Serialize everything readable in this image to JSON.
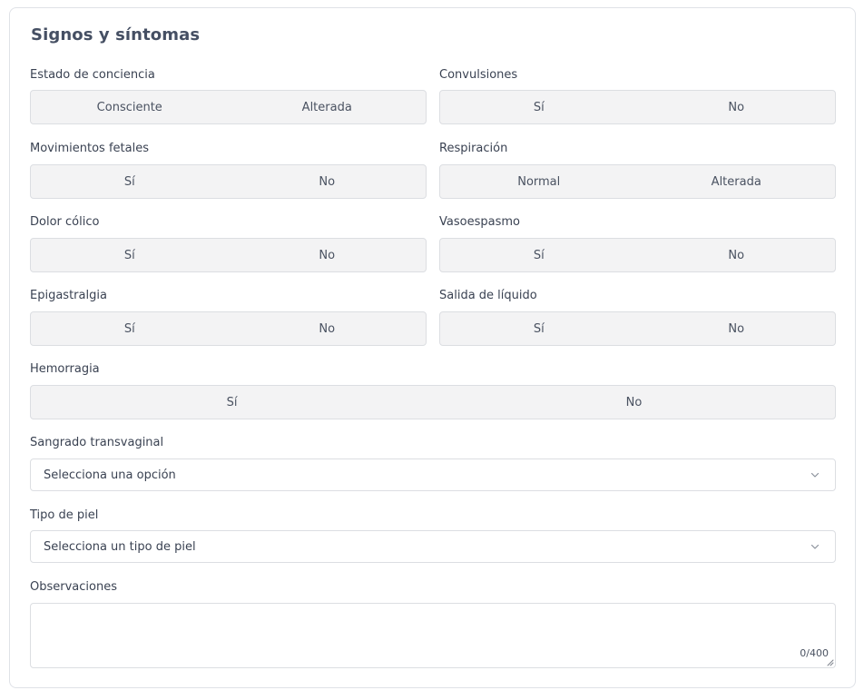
{
  "section": {
    "title": "Signos y síntomas"
  },
  "fields": {
    "estado_conciencia": {
      "label": "Estado de conciencia",
      "options": [
        "Consciente",
        "Alterada"
      ]
    },
    "convulsiones": {
      "label": "Convulsiones",
      "options": [
        "Sí",
        "No"
      ]
    },
    "movimientos_fetales": {
      "label": "Movimientos fetales",
      "options": [
        "Sí",
        "No"
      ]
    },
    "respiracion": {
      "label": "Respiración",
      "options": [
        "Normal",
        "Alterada"
      ]
    },
    "dolor_colico": {
      "label": "Dolor cólico",
      "options": [
        "Sí",
        "No"
      ]
    },
    "vasoespasmo": {
      "label": "Vasoespasmo",
      "options": [
        "Sí",
        "No"
      ]
    },
    "epigastralgia": {
      "label": "Epigastralgia",
      "options": [
        "Sí",
        "No"
      ]
    },
    "salida_liquido": {
      "label": "Salida de líquido",
      "options": [
        "Sí",
        "No"
      ]
    },
    "hemorragia": {
      "label": "Hemorragia",
      "options": [
        "Sí",
        "No"
      ]
    },
    "sangrado_transvaginal": {
      "label": "Sangrado transvaginal",
      "value": "Selecciona una opción"
    },
    "tipo_piel": {
      "label": "Tipo de piel",
      "value": "Selecciona un tipo de piel"
    },
    "observaciones": {
      "label": "Observaciones",
      "value": "",
      "counter": "0/400"
    }
  },
  "icons": {
    "select_chevron": "chevron-down-icon",
    "resize": "resize-handle-icon"
  },
  "colors": {
    "segment_bg": "#f3f3f4",
    "border": "#dcdee2",
    "title": "#454f63"
  }
}
